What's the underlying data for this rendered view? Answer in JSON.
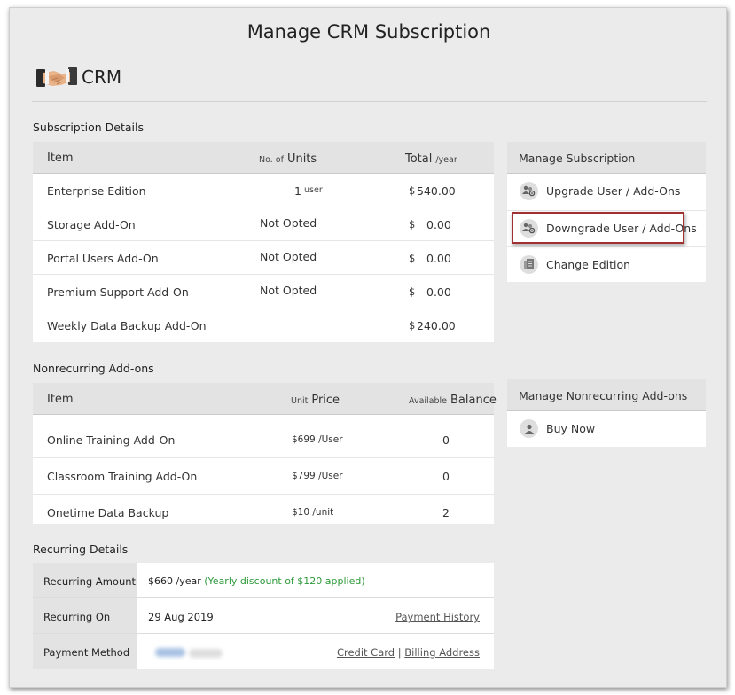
{
  "page": {
    "title": "Manage CRM Subscription",
    "app_name": "CRM"
  },
  "subscription": {
    "section_title": "Subscription Details",
    "headers": {
      "item": "Item",
      "units_small": "No. of",
      "units": "Units",
      "total": "Total",
      "total_small": "/year"
    },
    "rows": [
      {
        "item": "Enterprise Edition",
        "units": "1",
        "unit_suffix": "user",
        "currency": "$",
        "total": "540.00"
      },
      {
        "item": "Storage Add-On",
        "units": "Not Opted",
        "unit_suffix": "",
        "currency": "$",
        "total": "0.00"
      },
      {
        "item": "Portal Users Add-On",
        "units": "Not Opted",
        "unit_suffix": "",
        "currency": "$",
        "total": "0.00"
      },
      {
        "item": "Premium Support Add-On",
        "units": "Not Opted",
        "unit_suffix": "",
        "currency": "$",
        "total": "0.00"
      },
      {
        "item": "Weekly Data Backup Add-On",
        "units": "-",
        "unit_suffix": "",
        "currency": "$",
        "total": "240.00"
      }
    ]
  },
  "manage_subscription": {
    "title": "Manage Subscription",
    "items": [
      {
        "label": "Upgrade User / Add-Ons",
        "icon": "users-gear-icon"
      },
      {
        "label": "Downgrade User / Add-Ons",
        "icon": "users-gear-icon"
      },
      {
        "label": "Change Edition",
        "icon": "documents-icon"
      }
    ]
  },
  "nonrecurring": {
    "section_title": "Nonrecurring Add-ons",
    "headers": {
      "item": "Item",
      "price_small": "Unit",
      "price": "Price",
      "balance_small": "Available",
      "balance": "Balance"
    },
    "rows": [
      {
        "item": "Online Training Add-On",
        "price": "$699",
        "price_unit": "/User",
        "balance": "0"
      },
      {
        "item": "Classroom Training Add-On",
        "price": "$799",
        "price_unit": "/User",
        "balance": "0"
      },
      {
        "item": "Onetime Data Backup",
        "price": "$10",
        "price_unit": "/unit",
        "balance": "2"
      }
    ]
  },
  "manage_nonrecurring": {
    "title": "Manage Nonrecurring Add-ons",
    "items": [
      {
        "label": "Buy Now",
        "icon": "user-icon"
      }
    ]
  },
  "recurring": {
    "section_title": "Recurring Details",
    "amount_label": "Recurring Amount",
    "amount": "$660",
    "amount_unit": "/year",
    "discount": "(Yearly discount of $120 applied)",
    "on_label": "Recurring On",
    "on_value": "29 Aug 2019",
    "payment_history": "Payment History",
    "method_label": "Payment Method",
    "credit_card": "Credit Card",
    "separator": "|",
    "billing_address": "Billing Address"
  },
  "colors": {
    "frame_bg": "#ebebeb",
    "header_bg": "#e3e3e3",
    "highlight": "#a33030",
    "discount_green": "#2e9a3b"
  }
}
